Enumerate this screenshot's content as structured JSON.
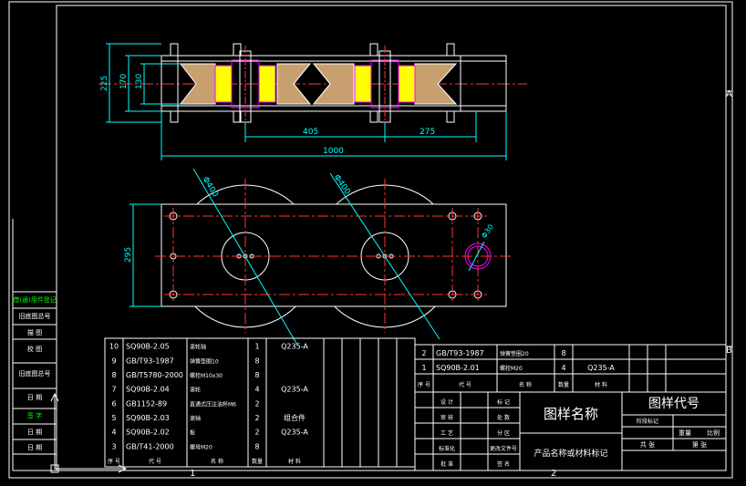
{
  "colors": {
    "background": "#000000",
    "frame": "#ffffff",
    "dimension": "#00ffff",
    "centerline": "#ff3333",
    "part": "#ffffff",
    "bearing": "#ffff00",
    "magenta": "#ff00ff",
    "tan": "#c8a070",
    "green": "#00ff00"
  },
  "zones": {
    "right_a": "A",
    "right_b": "B",
    "bottom_1": "1",
    "bottom_2": "2"
  },
  "top_view": {
    "dims": {
      "d225": "225",
      "d170": "170",
      "d130": "130",
      "d405": "405",
      "d275": "275",
      "d1000": "1000"
    }
  },
  "bottom_view": {
    "dims": {
      "d295": "295",
      "wheel_left": "Φ400",
      "wheel_right": "Φ400",
      "hole": "Φ30"
    }
  },
  "left_strip": [
    "借(通)用件登记",
    "旧底图总号",
    "描 图",
    "校 图",
    "旧底图总号",
    "日 期",
    "签 字",
    "日 期",
    "日 期"
  ],
  "bom_rows": [
    {
      "no": "10",
      "code": "SQ90B-2.05",
      "name": "滚轮轴",
      "qty": "1",
      "mat": "Q235-A"
    },
    {
      "no": "9",
      "code": "GB/T93-1987",
      "name": "弹簧垫圈10",
      "qty": "8",
      "mat": ""
    },
    {
      "no": "8",
      "code": "GB/T5780-2000",
      "name": "螺栓M10x30",
      "qty": "8",
      "mat": ""
    },
    {
      "no": "7",
      "code": "SQ90B-2.04",
      "name": "滚轮",
      "qty": "4",
      "mat": "Q235-A"
    },
    {
      "no": "6",
      "code": "GB1152-89",
      "name": "直通式压注油杯M6",
      "qty": "2",
      "mat": ""
    },
    {
      "no": "5",
      "code": "SQ90B-2.03",
      "name": "滚轴",
      "qty": "2",
      "mat": "组合件"
    },
    {
      "no": "4",
      "code": "SQ90B-2.02",
      "name": "板",
      "qty": "2",
      "mat": "Q235-A"
    },
    {
      "no": "3",
      "code": "GB/T41-2000",
      "name": "螺母M20",
      "qty": "8",
      "mat": ""
    }
  ],
  "bom_header": {
    "no": "序 号",
    "code": "代 号",
    "name": "名 称",
    "qty": "数量",
    "mat": "材 料"
  },
  "right_rows": [
    {
      "no": "2",
      "code": "GB/T93-1987",
      "name": "弹簧垫圈20",
      "qty": "8",
      "mat": ""
    },
    {
      "no": "1",
      "code": "SQ90B-2.01",
      "name": "螺栓M20",
      "qty": "4",
      "mat": "Q235-A"
    }
  ],
  "title_block": {
    "drawing_name": "图样名称",
    "drawing_code": "图样代号",
    "product_name": "产品名称或材料标记",
    "stage_label": "阶段标记",
    "weight_label": "重量",
    "scale_label": "比例",
    "sheet_total": "共 张",
    "sheet_no": "第 张",
    "roles": [
      "设 计",
      "审 核",
      "工 艺",
      "标准化",
      "批 准"
    ],
    "roles2": [
      "标 记",
      "处 数",
      "分 区",
      "更改文件号",
      "签 名"
    ]
  }
}
